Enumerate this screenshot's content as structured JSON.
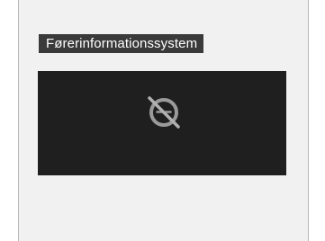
{
  "section": {
    "title": "Førerinformationssystem"
  },
  "display": {
    "icon": "no-display-icon",
    "background_color": "#1f1f1f",
    "icon_color": "#9a9a9a"
  }
}
